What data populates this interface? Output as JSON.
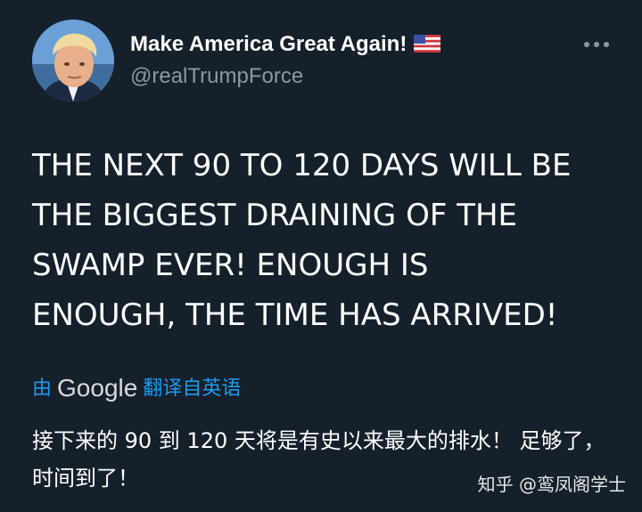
{
  "tweet": {
    "display_name": "Make America Great Again!",
    "handle": "@realTrumpForce",
    "body": "THE NEXT 90 TO 120 DAYS WILL BE\nTHE BIGGEST DRAINING OF THE\nSWAMP EVER!  ENOUGH IS\nENOUGH, THE TIME HAS ARRIVED!",
    "icons": {
      "avatar": "profile-photo",
      "flag": "us-flag-emoji",
      "more": "more-horizontal-icon"
    }
  },
  "translation": {
    "by_label": "由",
    "provider": "Google",
    "action_label": "翻译自英语",
    "text": "接下来的 90 到 120 天将是有史以来最大的排水！ 足够了，时间到了！"
  },
  "watermark": {
    "text": "知乎 @鸾凤阁学士"
  },
  "colors": {
    "background": "#15202b",
    "secondary_text": "#8899a6",
    "link": "#1d9bf0"
  }
}
